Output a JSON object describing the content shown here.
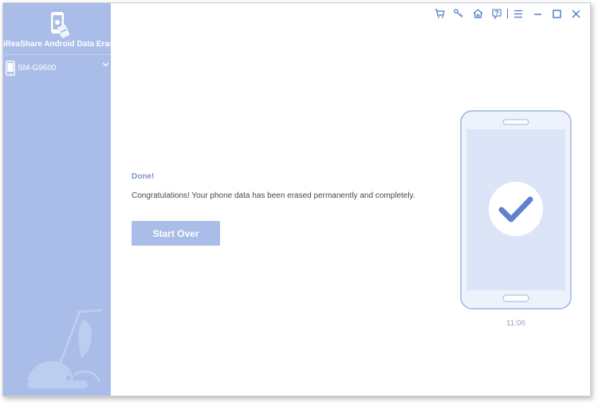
{
  "app": {
    "title": "iReaShare Android Data Eraser",
    "icons": {
      "logo": "phone-eraser-logo-icon",
      "cart": "cart-icon",
      "key": "key-icon",
      "home": "home-icon",
      "help": "help-icon",
      "menu": "menu-icon",
      "minimize": "minimize-icon",
      "maximize": "maximize-icon",
      "close": "close-icon"
    }
  },
  "sidebar": {
    "device": {
      "name": "SM-G9600",
      "icon": "phone-icon",
      "expand_icon": "chevron-down-icon"
    },
    "decoration": "vacuum-cleaner-icon"
  },
  "main": {
    "done_title": "Done!",
    "message": "Congratulations! Your phone data has been erased permanently and completely.",
    "start_over_label": "Start Over"
  },
  "phone": {
    "time": "11:06",
    "status_icon": "checkmark-icon"
  },
  "colors": {
    "sidebar": "#a9bde8",
    "accent": "#4a78c8",
    "button": "#a9bde8",
    "done_title": "#7b96cf",
    "phone_screen": "#dce5f8",
    "checkmark": "#5f82cc"
  }
}
